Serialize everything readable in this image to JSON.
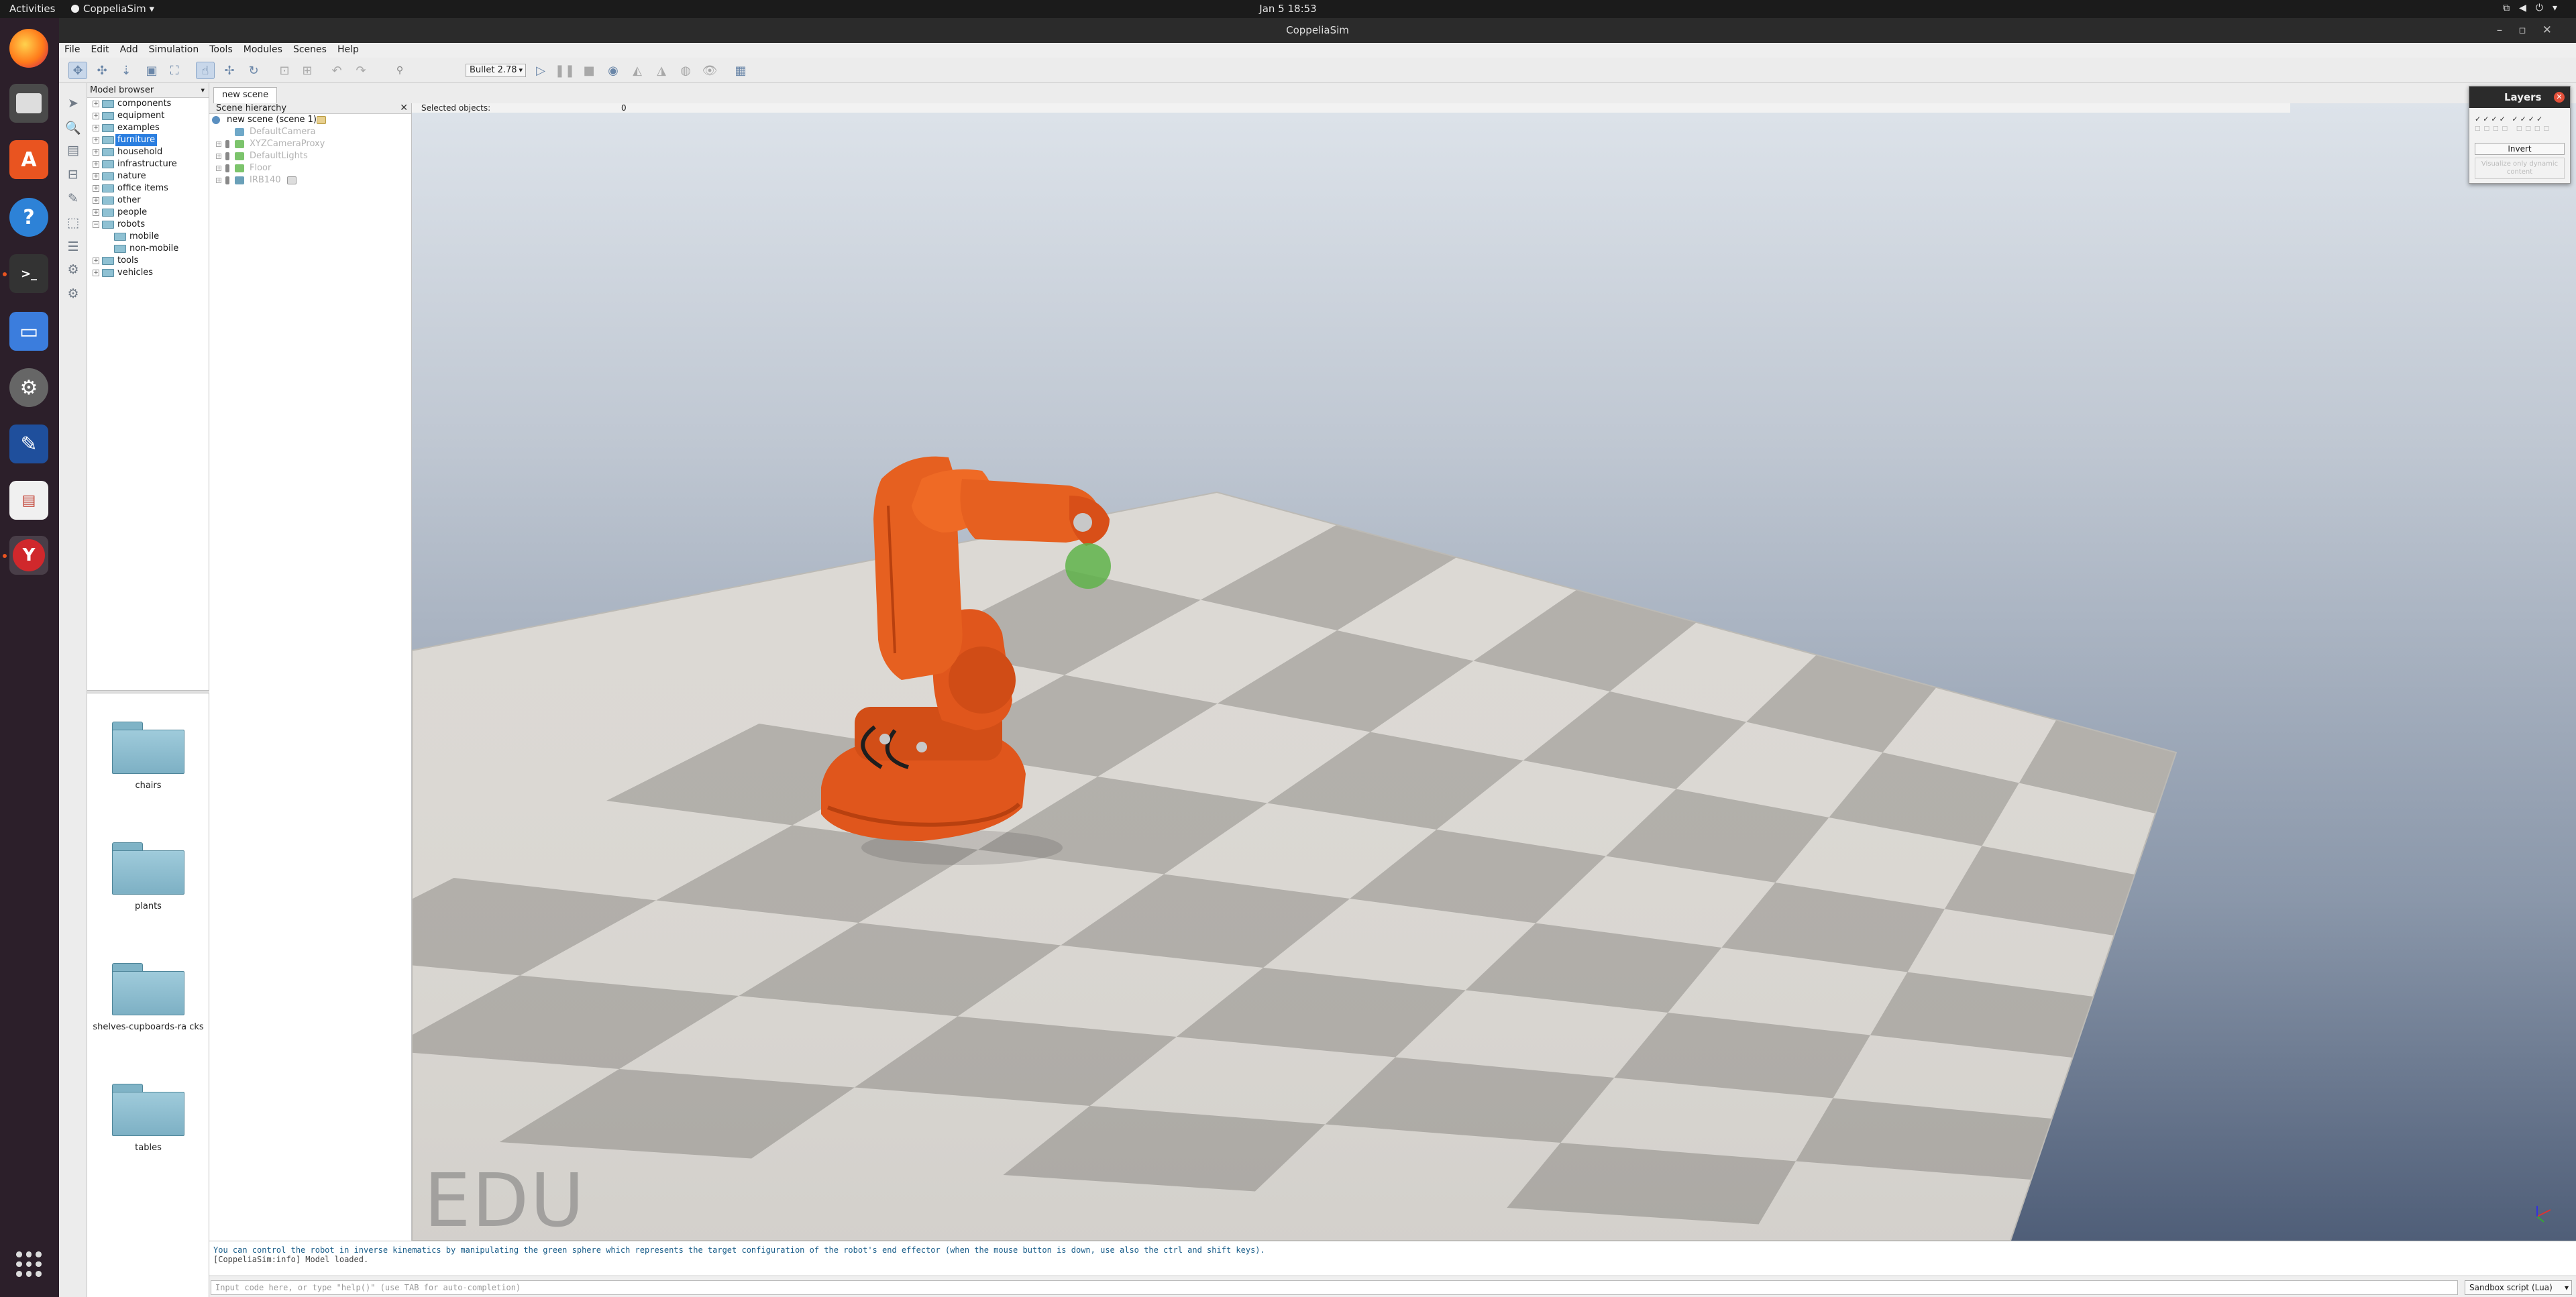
{
  "topbar": {
    "activities": "Activities",
    "app_name": "CoppeliaSim",
    "clock": "Jan 5  18:53"
  },
  "window": {
    "title": "CoppeliaSim"
  },
  "menu": [
    "File",
    "Edit",
    "Add",
    "Simulation",
    "Tools",
    "Modules",
    "Scenes",
    "Help"
  ],
  "toolbar": {
    "physics_engine": "Bullet 2.78"
  },
  "model_browser": {
    "title": "Model browser",
    "tree": [
      {
        "label": "components",
        "depth": 0,
        "expanded": false,
        "selected": false
      },
      {
        "label": "equipment",
        "depth": 0,
        "expanded": false,
        "selected": false
      },
      {
        "label": "examples",
        "depth": 0,
        "expanded": false,
        "selected": false
      },
      {
        "label": "furniture",
        "depth": 0,
        "expanded": false,
        "selected": true
      },
      {
        "label": "household",
        "depth": 0,
        "expanded": false,
        "selected": false
      },
      {
        "label": "infrastructure",
        "depth": 0,
        "expanded": false,
        "selected": false
      },
      {
        "label": "nature",
        "depth": 0,
        "expanded": false,
        "selected": false
      },
      {
        "label": "office items",
        "depth": 0,
        "expanded": false,
        "selected": false
      },
      {
        "label": "other",
        "depth": 0,
        "expanded": false,
        "selected": false
      },
      {
        "label": "people",
        "depth": 0,
        "expanded": false,
        "selected": false
      },
      {
        "label": "robots",
        "depth": 0,
        "expanded": true,
        "selected": false
      },
      {
        "label": "mobile",
        "depth": 1,
        "expanded": false,
        "selected": false
      },
      {
        "label": "non-mobile",
        "depth": 1,
        "expanded": false,
        "selected": false
      },
      {
        "label": "tools",
        "depth": 0,
        "expanded": false,
        "selected": false
      },
      {
        "label": "vehicles",
        "depth": 0,
        "expanded": false,
        "selected": false
      }
    ],
    "thumbnails": [
      "chairs",
      "plants",
      "shelves-cupboards-ra cks",
      "tables"
    ]
  },
  "scene": {
    "tab": "new scene",
    "hierarchy_title": "Scene hierarchy",
    "root": "new scene (scene 1)",
    "objects": [
      {
        "label": "DefaultCamera",
        "icon_color": "#6fa8c8",
        "has_children": false
      },
      {
        "label": "XYZCameraProxy",
        "icon_color": "#7cc46c",
        "has_children": true
      },
      {
        "label": "DefaultLights",
        "icon_color": "#7cc46c",
        "has_children": true
      },
      {
        "label": "Floor",
        "icon_color": "#7cc46c",
        "has_children": true
      },
      {
        "label": "IRB140",
        "icon_color": "#6aa0b8",
        "has_children": true
      }
    ]
  },
  "viewport": {
    "selected_label": "Selected objects:",
    "selected_count": "0",
    "watermark": "EDU"
  },
  "layers": {
    "title": "Layers",
    "checks": "✓✓✓✓ ✓✓✓✓",
    "invert": "Invert",
    "visualize": "Visualize only dynamic content"
  },
  "console": {
    "line1": "You can control the robot in inverse kinematics by manipulating the green sphere which represents the target configuration of the robot's end effector (when the mouse button is down, use also the ctrl and shift keys).",
    "line2": "[CoppeliaSim:info] Model loaded."
  },
  "command": {
    "placeholder": "Input code here, or type \"help()\" (use TAB for auto-completion)",
    "script": "Sandbox script (Lua)"
  }
}
